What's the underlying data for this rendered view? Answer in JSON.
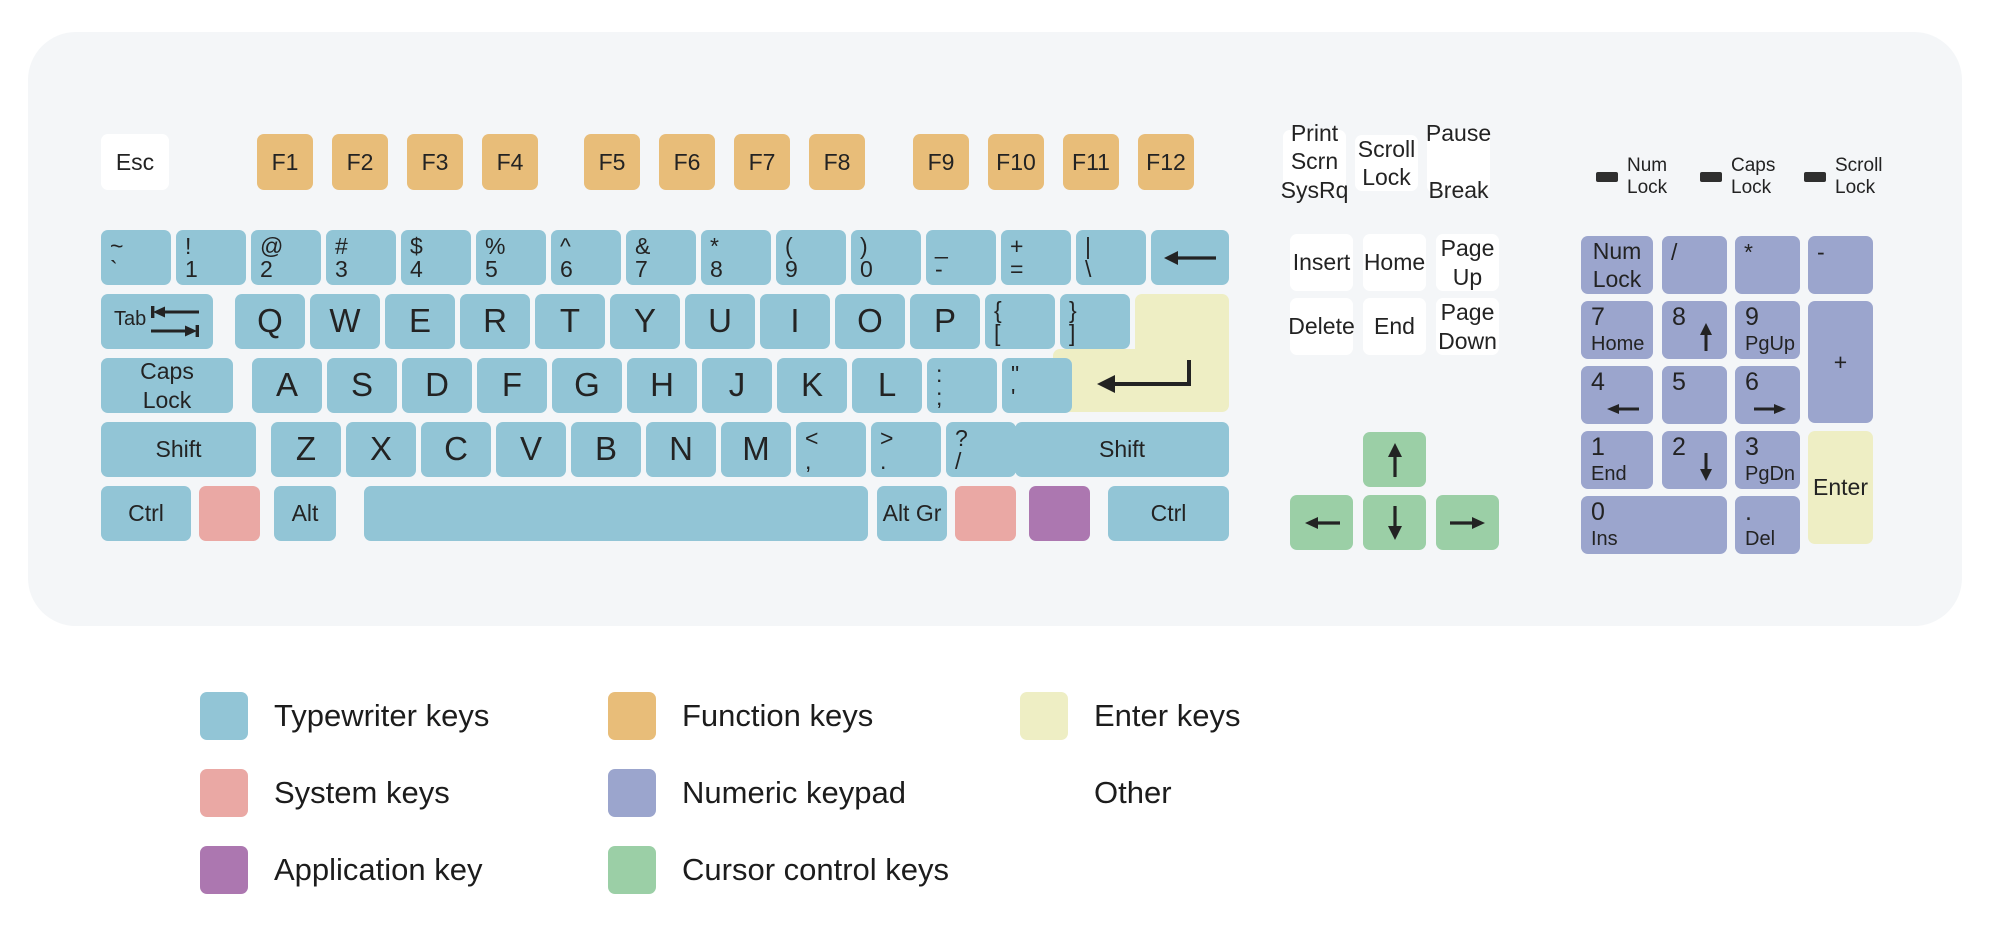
{
  "diagram": {
    "title": "PC keyboard layout diagram",
    "body_color": "#f4f6f8",
    "page_background": "#ffffff"
  },
  "colors": {
    "typewriter": "#92c5d6",
    "function": "#e8bd79",
    "enter": "#eeeec4",
    "system": "#eaa8a4",
    "numeric": "#9ba5cd",
    "application": "#ac77b0",
    "cursor": "#9bcfa6",
    "other": "#ffffff",
    "text": "#232323"
  },
  "function_row": {
    "esc": "Esc",
    "group1": [
      "F1",
      "F2",
      "F3",
      "F4"
    ],
    "group2": [
      "F5",
      "F6",
      "F7",
      "F8"
    ],
    "group3": [
      "F9",
      "F10",
      "F11",
      "F12"
    ]
  },
  "number_row": {
    "keys": [
      {
        "top": "~",
        "bottom": "`"
      },
      {
        "top": "!",
        "bottom": "1"
      },
      {
        "top": "@",
        "bottom": "2"
      },
      {
        "top": "#",
        "bottom": "3"
      },
      {
        "top": "$",
        "bottom": "4"
      },
      {
        "top": "%",
        "bottom": "5"
      },
      {
        "top": "^",
        "bottom": "6"
      },
      {
        "top": "&",
        "bottom": "7"
      },
      {
        "top": "*",
        "bottom": "8"
      },
      {
        "top": "(",
        "bottom": "9"
      },
      {
        "top": ")",
        "bottom": "0"
      },
      {
        "top": "_",
        "bottom": "-"
      },
      {
        "top": "+",
        "bottom": "="
      },
      {
        "top": "|",
        "bottom": "\\"
      }
    ],
    "backspace": "backspace-arrow-icon"
  },
  "qwerty_row": {
    "tab": "Tab",
    "tab_icon": "tab-arrows-icon",
    "letters": [
      "Q",
      "W",
      "E",
      "R",
      "T",
      "Y",
      "U",
      "I",
      "O",
      "P"
    ],
    "bracket_left": {
      "top": "{",
      "bottom": "["
    },
    "bracket_right": {
      "top": "}",
      "bottom": "]"
    }
  },
  "home_row": {
    "caps_lock": "Caps\nLock",
    "letters": [
      "A",
      "S",
      "D",
      "F",
      "G",
      "H",
      "J",
      "K",
      "L"
    ],
    "semicolon": {
      "top": ":",
      "bottom": ";"
    },
    "quote": {
      "top": "\"",
      "bottom": "'"
    },
    "enter_icon": "enter-return-arrow-icon"
  },
  "shift_row": {
    "shift_left": "Shift",
    "letters": [
      "Z",
      "X",
      "C",
      "V",
      "B",
      "N",
      "M"
    ],
    "comma": {
      "top": "<",
      "bottom": ","
    },
    "period": {
      "top": ">",
      "bottom": "."
    },
    "slash": {
      "top": "?",
      "bottom": "/"
    },
    "shift_right": "Shift"
  },
  "bottom_row": {
    "ctrl_left": "Ctrl",
    "win_left": "",
    "alt": "Alt",
    "space": "",
    "alt_gr": "Alt Gr",
    "win_right": "",
    "application": "",
    "ctrl_right": "Ctrl"
  },
  "nav_cluster": {
    "print_screen": "Print\nScrn\nSysRq",
    "scroll_lock": "Scroll\nLock",
    "pause_break": "Pause\n\nBreak",
    "insert": "Insert",
    "home": "Home",
    "page_up": "Page\nUp",
    "delete": "Delete",
    "end": "End",
    "page_down": "Page\nDown"
  },
  "cursor_keys": {
    "up": "up-arrow-icon",
    "left": "left-arrow-icon",
    "down": "down-arrow-icon",
    "right": "right-arrow-icon"
  },
  "leds": [
    {
      "label": "Num\nLock"
    },
    {
      "label": "Caps\nLock"
    },
    {
      "label": "Scroll\nLock"
    }
  ],
  "numpad": {
    "num_lock": "Num\nLock",
    "divide": "/",
    "multiply": "*",
    "subtract": "-",
    "add": "+",
    "enter": "Enter",
    "k7": {
      "num": "7",
      "sub": "Home"
    },
    "k8": {
      "num": "8",
      "sub": "",
      "arrow": "up-arrow-icon"
    },
    "k9": {
      "num": "9",
      "sub": "PgUp"
    },
    "k4": {
      "num": "4",
      "sub": "",
      "arrow": "left-arrow-icon"
    },
    "k5": {
      "num": "5",
      "sub": ""
    },
    "k6": {
      "num": "6",
      "sub": "",
      "arrow": "right-arrow-icon"
    },
    "k1": {
      "num": "1",
      "sub": "End"
    },
    "k2": {
      "num": "2",
      "sub": "",
      "arrow": "down-arrow-icon"
    },
    "k3": {
      "num": "3",
      "sub": "PgDn"
    },
    "k0": {
      "num": "0",
      "sub": "Ins"
    },
    "kdot": {
      "num": ".",
      "sub": "Del"
    }
  },
  "legend": {
    "items": [
      {
        "label": "Typewriter keys",
        "color": "#92c5d6",
        "col": 0,
        "row": 0
      },
      {
        "label": "Function keys",
        "color": "#e8bd79",
        "col": 1,
        "row": 0
      },
      {
        "label": "Enter keys",
        "color": "#eeeec4",
        "col": 2,
        "row": 0
      },
      {
        "label": "System keys",
        "color": "#eaa8a4",
        "col": 0,
        "row": 1
      },
      {
        "label": "Numeric keypad",
        "color": "#9ba5cd",
        "col": 1,
        "row": 1
      },
      {
        "label": "Other",
        "color": "",
        "col": 2,
        "row": 1
      },
      {
        "label": "Application key",
        "color": "#ac77b0",
        "col": 0,
        "row": 2
      },
      {
        "label": "Cursor control keys",
        "color": "#9bcfa6",
        "col": 1,
        "row": 2
      }
    ]
  }
}
